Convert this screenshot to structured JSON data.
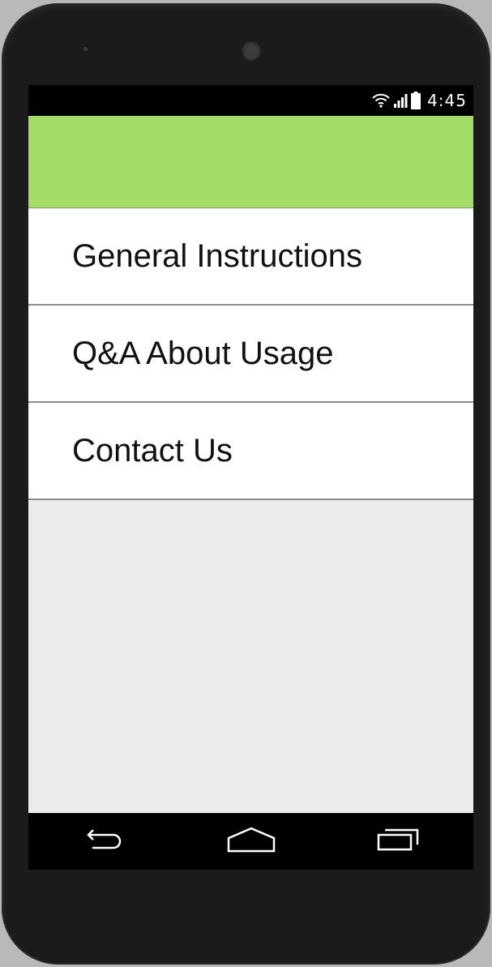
{
  "status_bar": {
    "time": "4:45",
    "icons": [
      "wifi-icon",
      "signal-icon",
      "battery-icon"
    ]
  },
  "app_bar": {
    "color": "#a4dc68"
  },
  "menu": {
    "items": [
      {
        "label": "General Instructions"
      },
      {
        "label": "Q&A About Usage"
      },
      {
        "label": "Contact Us"
      }
    ]
  },
  "nav_bar": {
    "buttons": [
      "back-icon",
      "home-icon",
      "recent-apps-icon"
    ]
  }
}
